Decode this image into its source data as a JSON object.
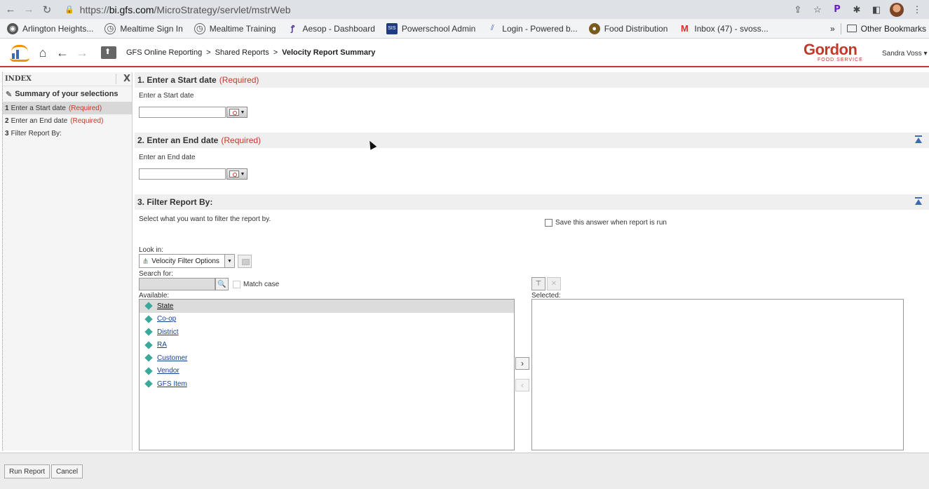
{
  "browser": {
    "url_prefix": "https://",
    "url_host": "bi.gfs.com",
    "url_path": "/MicroStrategy/servlet/mstrWeb",
    "bookmarks": [
      {
        "label": "Arlington Heights...",
        "icon": "globe-icon"
      },
      {
        "label": "Mealtime Sign In",
        "icon": "clock-icon"
      },
      {
        "label": "Mealtime Training",
        "icon": "clock-icon"
      },
      {
        "label": "Aesop - Dashboard",
        "icon": "aesop-icon"
      },
      {
        "label": "Powerschool Admin",
        "icon": "sis-icon"
      },
      {
        "label": "Login - Powered b...",
        "icon": "login-icon"
      },
      {
        "label": "Food Distribution",
        "icon": "food-icon"
      },
      {
        "label": "Inbox (47) - svoss...",
        "icon": "gmail-icon"
      }
    ],
    "more_bookmarks": "»",
    "other_bookmarks": "Other Bookmarks"
  },
  "app": {
    "breadcrumb_root": "GFS Online Reporting",
    "breadcrumb_sep": ">",
    "breadcrumb_mid": "Shared Reports",
    "breadcrumb_current": "Velocity Report Summary",
    "brand_name": "Gordon",
    "brand_sub": "FOOD SERVICE",
    "user_name": "Sandra Voss",
    "brand_color": "#c23a2b"
  },
  "index": {
    "title": "INDEX",
    "close": "X",
    "summary": "Summary of your selections",
    "items": [
      {
        "num": "1",
        "label": "Enter a Start date",
        "req": "(Required)"
      },
      {
        "num": "2",
        "label": "Enter an End date",
        "req": "(Required)"
      },
      {
        "num": "3",
        "label": "Filter Report By:",
        "req": ""
      }
    ]
  },
  "sections": {
    "start": {
      "title": "1. Enter a Start date",
      "req": "(Required)",
      "desc": "Enter a Start date"
    },
    "end": {
      "title": "2. Enter an End date",
      "req": "(Required)",
      "desc": "Enter an End date"
    },
    "filter": {
      "title": "3. Filter Report By:",
      "desc": "Select what you want to filter the report by.",
      "save_answer": "Save this answer when report is run",
      "look_in_label": "Look in:",
      "look_in_value": "Velocity Filter Options",
      "search_label": "Search for:",
      "match_case": "Match case",
      "available_label": "Available:",
      "selected_label": "Selected:",
      "available": [
        "State",
        "Co-op",
        "District",
        "RA",
        "Customer",
        "Vendor",
        "GFS Item"
      ]
    }
  },
  "footer": {
    "run": "Run Report",
    "cancel": "Cancel"
  }
}
